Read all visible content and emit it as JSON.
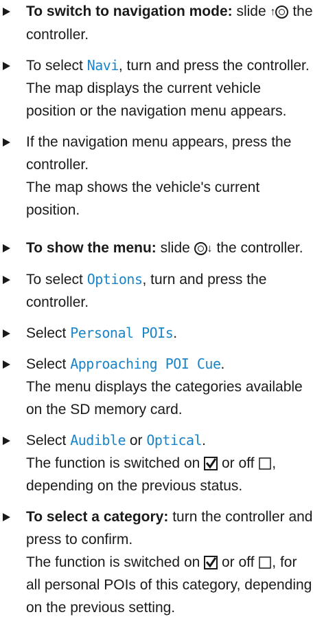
{
  "steps": [
    {
      "bold": "To switch to navigation mode:",
      "pre": " slide ",
      "arrow": "↑",
      "post": " the controller."
    },
    {
      "pre": "To select ",
      "kw": "Navi",
      "post": ", turn and press the controller.",
      "result": "The map displays the current vehicle position or the navigation menu appears."
    },
    {
      "pre": "If the navigation menu appears, press the controller.",
      "result": "The map shows the vehicle's current position."
    },
    {
      "bold": "To show the menu:",
      "pre": " slide ",
      "arrow": "↓",
      "post": " the controller."
    },
    {
      "pre": "To select ",
      "kw": "Options",
      "post": ", turn and press the controller."
    },
    {
      "pre": "Select ",
      "kw": "Personal POIs",
      "post": "."
    },
    {
      "pre": "Select ",
      "kw": "Approaching POI Cue",
      "post": ".",
      "result": "The menu displays the categories available on the SD memory card."
    },
    {
      "pre": "Select ",
      "kw": "Audible",
      "mid": " or ",
      "kw2": "Optical",
      "post": ".",
      "result_pre": "The function is switched on ",
      "result_mid": " or off ",
      "result_post": ", depending on the previous status."
    },
    {
      "bold": "To select a category:",
      "pre": " turn the controller and press to confirm.",
      "result_pre": "The function is switched on ",
      "result_mid": " or off ",
      "result_post": ", for all personal POIs of this category, depending on the previous setting."
    }
  ],
  "colors": {
    "keyword": "#1a84c8",
    "text": "#1a1a1a"
  },
  "icons": {
    "bullet": "triangle-bullet-icon",
    "controller": "controller-icon",
    "checked": "checkbox-checked-icon",
    "unchecked": "checkbox-unchecked-icon"
  }
}
